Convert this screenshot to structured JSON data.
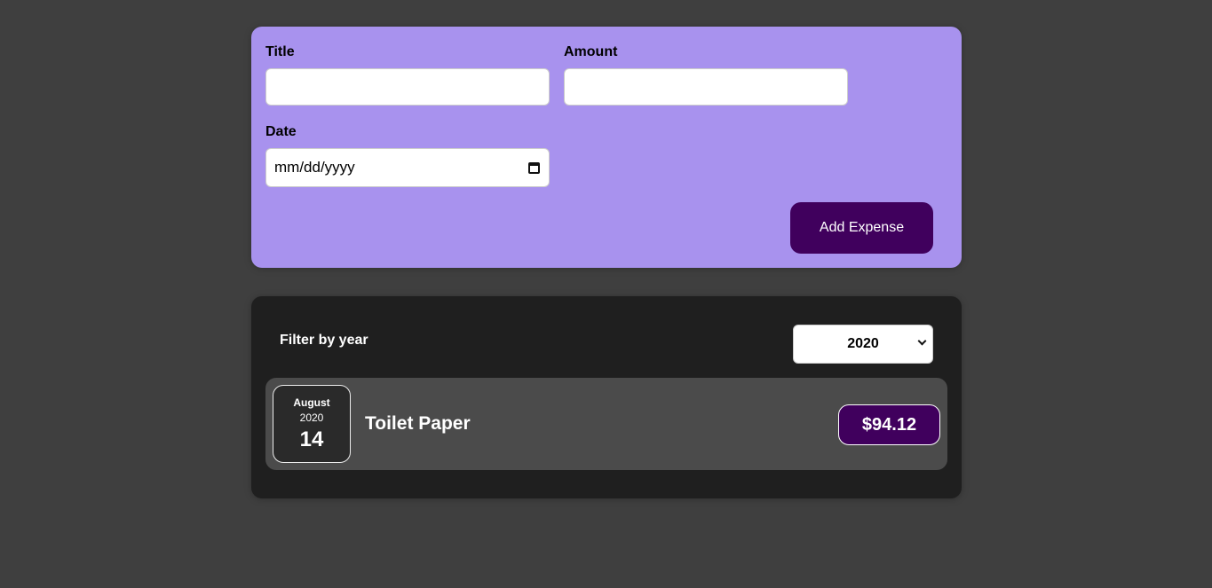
{
  "form": {
    "title_label": "Title",
    "title_value": "",
    "amount_label": "Amount",
    "amount_value": "",
    "date_label": "Date",
    "date_placeholder": "mm/dd/yyyy",
    "submit_label": "Add Expense"
  },
  "filter": {
    "label": "Filter by year",
    "selected_year": "2020"
  },
  "expenses": [
    {
      "month": "August",
      "year": "2020",
      "day": "14",
      "title": "Toilet Paper",
      "amount": "$94.12"
    }
  ],
  "colors": {
    "background": "#3f3f3f",
    "form_card": "#a892ee",
    "expenses_card": "#1f1f1f",
    "expense_item": "#4b4b4b",
    "accent": "#40005d"
  },
  "icons": {
    "date_picker": "calendar-icon",
    "select": "chevron-down-icon"
  }
}
